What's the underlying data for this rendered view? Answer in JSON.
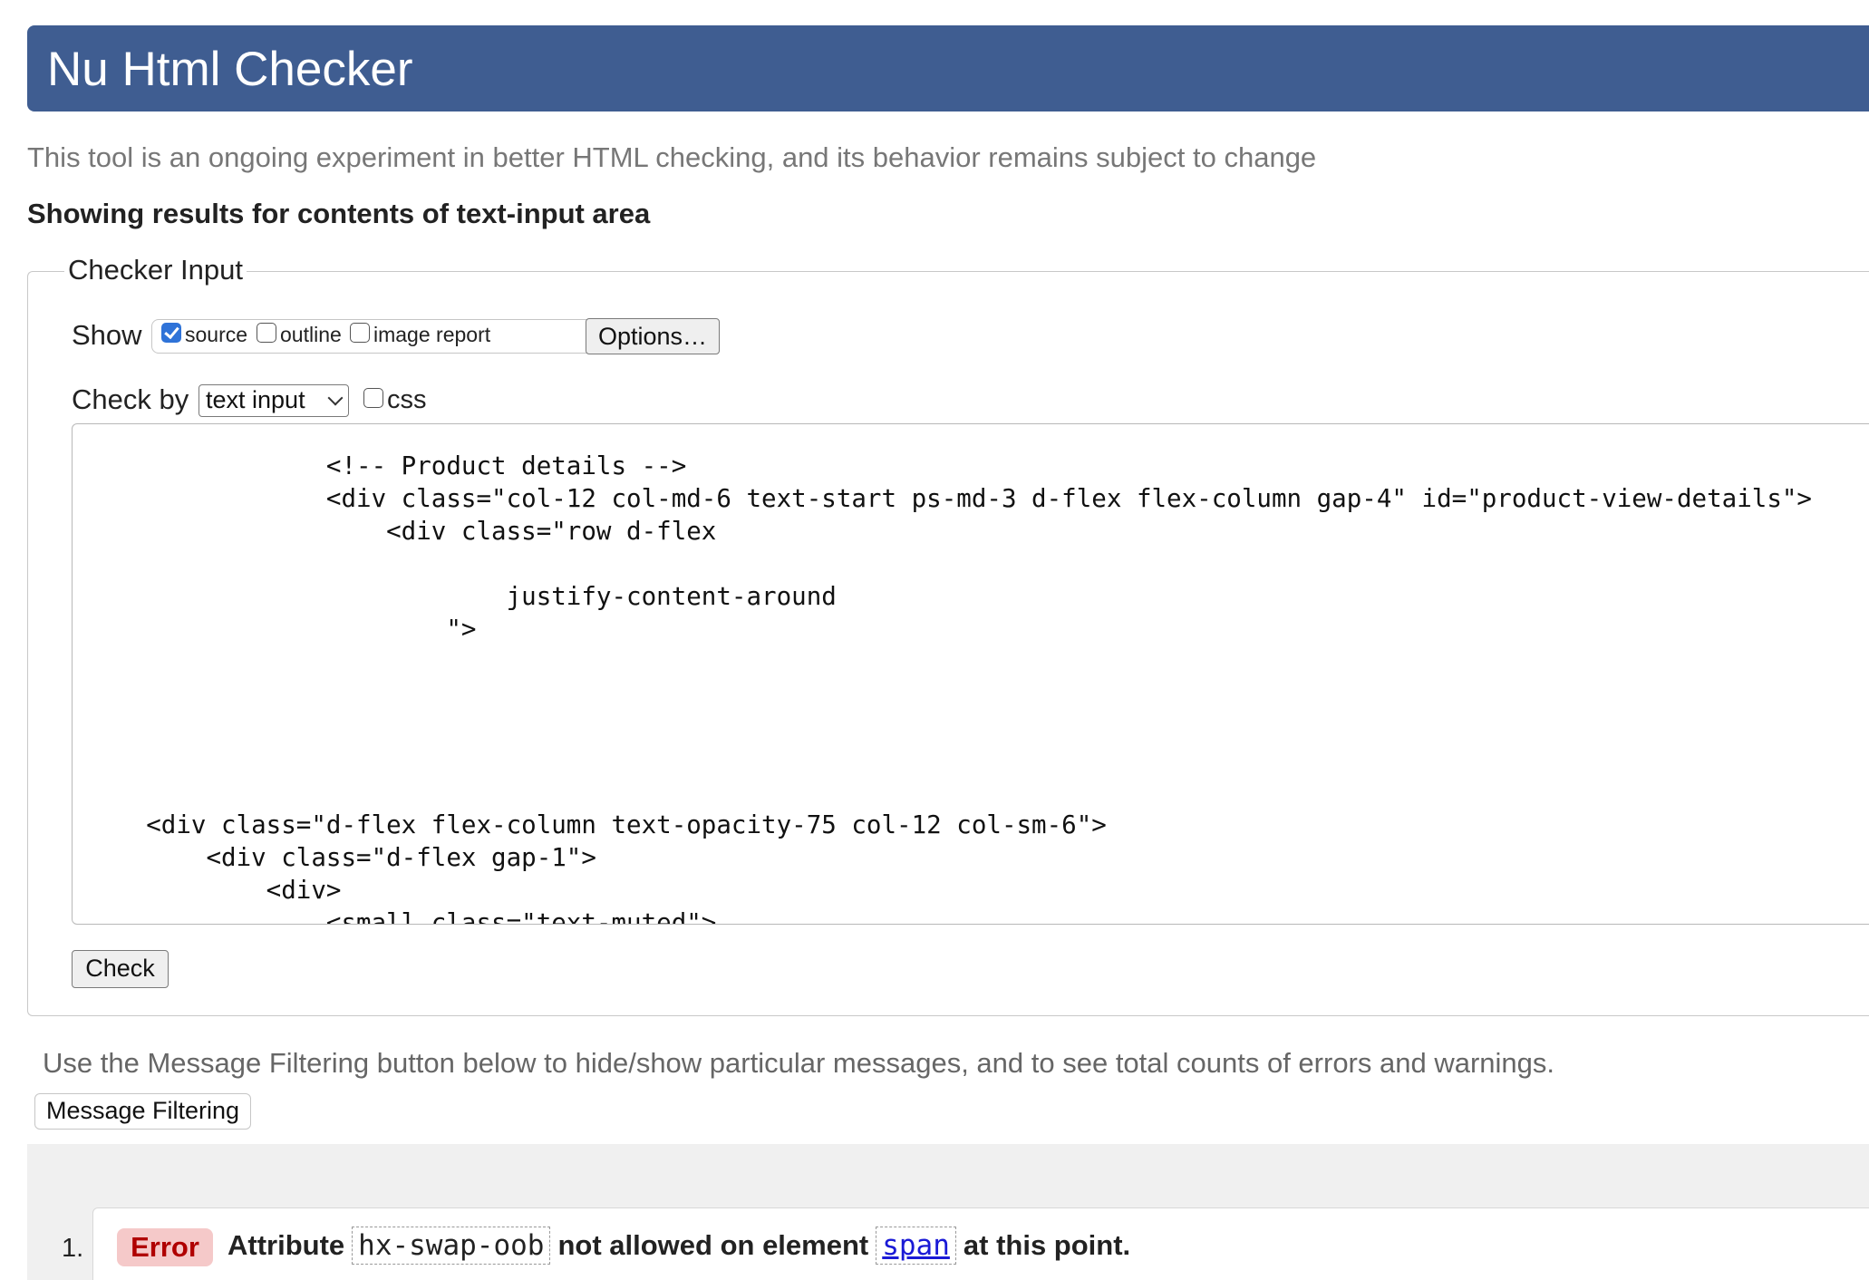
{
  "header": {
    "title": "Nu Html Checker"
  },
  "tagline": "This tool is an ongoing experiment in better HTML checking, and its behavior remains subject to change",
  "results_heading": "Showing results for contents of text-input area",
  "checker_input": {
    "legend": "Checker Input",
    "show_label": "Show",
    "show_options": [
      {
        "label": "source",
        "checked": true
      },
      {
        "label": "outline",
        "checked": false
      },
      {
        "label": "image report",
        "checked": false
      }
    ],
    "options_button": "Options…",
    "check_by_label": "Check by",
    "check_by_selected": "text input",
    "css_label": "css",
    "css_checked": false,
    "source_text": "                <!-- Product details -->\n                <div class=\"col-12 col-md-6 text-start ps-md-3 d-flex flex-column gap-4\" id=\"product-view-details\">\n                    <div class=\"row d-flex\n\n                            justify-content-around\n                        \">\n\n\n\n\n\n    <div class=\"d-flex flex-column text-opacity-75 col-12 col-sm-6\">\n        <div class=\"d-flex gap-1\">\n            <div>\n                <small class=\"text-muted\">",
    "check_button": "Check"
  },
  "filtering": {
    "hint": "Use the Message Filtering button below to hide/show particular messages, and to see total counts of errors and warnings.",
    "button": "Message Filtering"
  },
  "messages": [
    {
      "number": "1.",
      "type": "Error",
      "text_before": "Attribute",
      "attribute": "hx-swap-oob",
      "text_middle": "not allowed on element",
      "element": "span",
      "text_after": "at this point."
    }
  ],
  "colors": {
    "banner": "#3f5d91",
    "error_badge_bg": "#f5c9c9",
    "error_badge_text": "#b00000",
    "checkbox_checked": "#2f73d8"
  }
}
